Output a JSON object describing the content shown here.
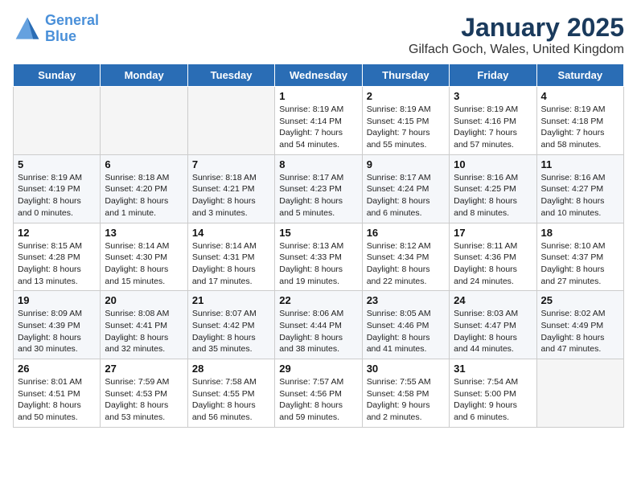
{
  "header": {
    "logo_line1": "General",
    "logo_line2": "Blue",
    "title": "January 2025",
    "subtitle": "Gilfach Goch, Wales, United Kingdom"
  },
  "days_of_week": [
    "Sunday",
    "Monday",
    "Tuesday",
    "Wednesday",
    "Thursday",
    "Friday",
    "Saturday"
  ],
  "weeks": [
    [
      {
        "day": "",
        "content": ""
      },
      {
        "day": "",
        "content": ""
      },
      {
        "day": "",
        "content": ""
      },
      {
        "day": "1",
        "content": "Sunrise: 8:19 AM\nSunset: 4:14 PM\nDaylight: 7 hours\nand 54 minutes."
      },
      {
        "day": "2",
        "content": "Sunrise: 8:19 AM\nSunset: 4:15 PM\nDaylight: 7 hours\nand 55 minutes."
      },
      {
        "day": "3",
        "content": "Sunrise: 8:19 AM\nSunset: 4:16 PM\nDaylight: 7 hours\nand 57 minutes."
      },
      {
        "day": "4",
        "content": "Sunrise: 8:19 AM\nSunset: 4:18 PM\nDaylight: 7 hours\nand 58 minutes."
      }
    ],
    [
      {
        "day": "5",
        "content": "Sunrise: 8:19 AM\nSunset: 4:19 PM\nDaylight: 8 hours\nand 0 minutes."
      },
      {
        "day": "6",
        "content": "Sunrise: 8:18 AM\nSunset: 4:20 PM\nDaylight: 8 hours\nand 1 minute."
      },
      {
        "day": "7",
        "content": "Sunrise: 8:18 AM\nSunset: 4:21 PM\nDaylight: 8 hours\nand 3 minutes."
      },
      {
        "day": "8",
        "content": "Sunrise: 8:17 AM\nSunset: 4:23 PM\nDaylight: 8 hours\nand 5 minutes."
      },
      {
        "day": "9",
        "content": "Sunrise: 8:17 AM\nSunset: 4:24 PM\nDaylight: 8 hours\nand 6 minutes."
      },
      {
        "day": "10",
        "content": "Sunrise: 8:16 AM\nSunset: 4:25 PM\nDaylight: 8 hours\nand 8 minutes."
      },
      {
        "day": "11",
        "content": "Sunrise: 8:16 AM\nSunset: 4:27 PM\nDaylight: 8 hours\nand 10 minutes."
      }
    ],
    [
      {
        "day": "12",
        "content": "Sunrise: 8:15 AM\nSunset: 4:28 PM\nDaylight: 8 hours\nand 13 minutes."
      },
      {
        "day": "13",
        "content": "Sunrise: 8:14 AM\nSunset: 4:30 PM\nDaylight: 8 hours\nand 15 minutes."
      },
      {
        "day": "14",
        "content": "Sunrise: 8:14 AM\nSunset: 4:31 PM\nDaylight: 8 hours\nand 17 minutes."
      },
      {
        "day": "15",
        "content": "Sunrise: 8:13 AM\nSunset: 4:33 PM\nDaylight: 8 hours\nand 19 minutes."
      },
      {
        "day": "16",
        "content": "Sunrise: 8:12 AM\nSunset: 4:34 PM\nDaylight: 8 hours\nand 22 minutes."
      },
      {
        "day": "17",
        "content": "Sunrise: 8:11 AM\nSunset: 4:36 PM\nDaylight: 8 hours\nand 24 minutes."
      },
      {
        "day": "18",
        "content": "Sunrise: 8:10 AM\nSunset: 4:37 PM\nDaylight: 8 hours\nand 27 minutes."
      }
    ],
    [
      {
        "day": "19",
        "content": "Sunrise: 8:09 AM\nSunset: 4:39 PM\nDaylight: 8 hours\nand 30 minutes."
      },
      {
        "day": "20",
        "content": "Sunrise: 8:08 AM\nSunset: 4:41 PM\nDaylight: 8 hours\nand 32 minutes."
      },
      {
        "day": "21",
        "content": "Sunrise: 8:07 AM\nSunset: 4:42 PM\nDaylight: 8 hours\nand 35 minutes."
      },
      {
        "day": "22",
        "content": "Sunrise: 8:06 AM\nSunset: 4:44 PM\nDaylight: 8 hours\nand 38 minutes."
      },
      {
        "day": "23",
        "content": "Sunrise: 8:05 AM\nSunset: 4:46 PM\nDaylight: 8 hours\nand 41 minutes."
      },
      {
        "day": "24",
        "content": "Sunrise: 8:03 AM\nSunset: 4:47 PM\nDaylight: 8 hours\nand 44 minutes."
      },
      {
        "day": "25",
        "content": "Sunrise: 8:02 AM\nSunset: 4:49 PM\nDaylight: 8 hours\nand 47 minutes."
      }
    ],
    [
      {
        "day": "26",
        "content": "Sunrise: 8:01 AM\nSunset: 4:51 PM\nDaylight: 8 hours\nand 50 minutes."
      },
      {
        "day": "27",
        "content": "Sunrise: 7:59 AM\nSunset: 4:53 PM\nDaylight: 8 hours\nand 53 minutes."
      },
      {
        "day": "28",
        "content": "Sunrise: 7:58 AM\nSunset: 4:55 PM\nDaylight: 8 hours\nand 56 minutes."
      },
      {
        "day": "29",
        "content": "Sunrise: 7:57 AM\nSunset: 4:56 PM\nDaylight: 8 hours\nand 59 minutes."
      },
      {
        "day": "30",
        "content": "Sunrise: 7:55 AM\nSunset: 4:58 PM\nDaylight: 9 hours\nand 2 minutes."
      },
      {
        "day": "31",
        "content": "Sunrise: 7:54 AM\nSunset: 5:00 PM\nDaylight: 9 hours\nand 6 minutes."
      },
      {
        "day": "",
        "content": ""
      }
    ]
  ]
}
